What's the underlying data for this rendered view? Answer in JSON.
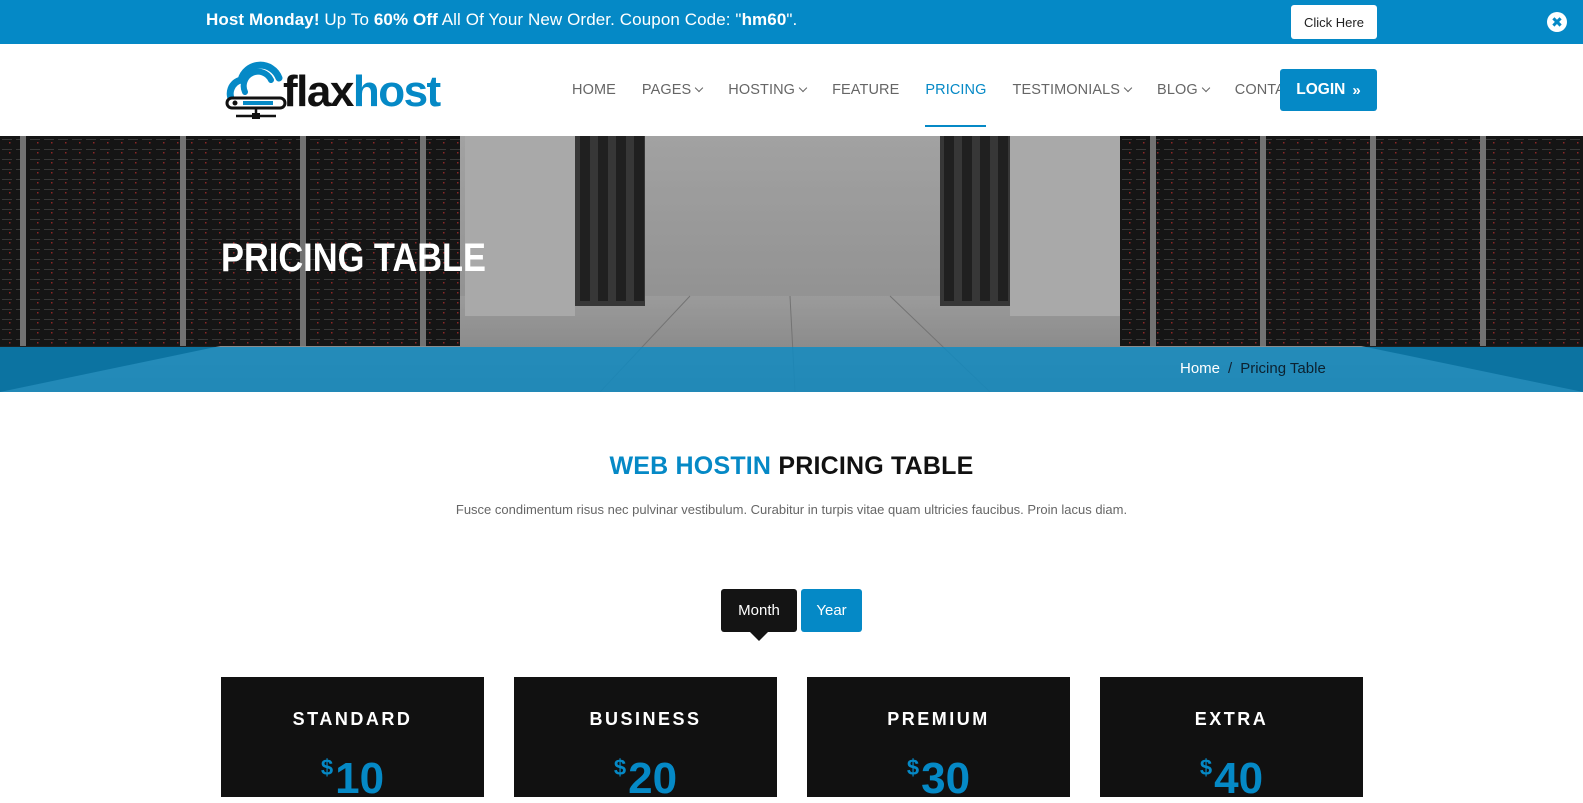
{
  "promo": {
    "strong_lead": "Host Monday!",
    "text_1": " Up To ",
    "strong_discount": "60% Off",
    "text_2": " All Of Your New Order. Coupon Code: \"",
    "strong_code": "hm60",
    "text_3": "\".",
    "button_label": "Click Here",
    "close_glyph": "✖"
  },
  "brand": {
    "part1": "flax",
    "part2": "host"
  },
  "nav": {
    "items": [
      {
        "label": "HOME",
        "dropdown": false
      },
      {
        "label": "PAGES",
        "dropdown": true
      },
      {
        "label": "HOSTING",
        "dropdown": true
      },
      {
        "label": "FEATURE",
        "dropdown": false
      },
      {
        "label": "PRICING",
        "dropdown": false,
        "active": true
      },
      {
        "label": "TESTIMONIALS",
        "dropdown": true
      },
      {
        "label": "BLOG",
        "dropdown": true
      },
      {
        "label": "CONTACT",
        "dropdown": false
      }
    ],
    "login_label": "LOGIN",
    "login_icon": "»"
  },
  "hero": {
    "title": "PRICING TABLE",
    "breadcrumb": {
      "home": "Home",
      "separator": "/",
      "current": "Pricing Table"
    }
  },
  "section": {
    "title_blue": "WEB HOSTIN",
    "title_dark": " PRICING TABLE",
    "description": "Fusce condimentum risus nec pulvinar vestibulum. Curabitur in turpis vitae quam ultricies faucibus. Proin lacus diam."
  },
  "billing_toggle": {
    "month_label": "Month",
    "year_label": "Year",
    "selected": "Month"
  },
  "plans": [
    {
      "name": "STANDARD",
      "currency": "$",
      "price": "10"
    },
    {
      "name": "BUSINESS",
      "currency": "$",
      "price": "20"
    },
    {
      "name": "PREMIUM",
      "currency": "$",
      "price": "30"
    },
    {
      "name": "EXTRA",
      "currency": "$",
      "price": "40"
    }
  ],
  "colors": {
    "accent": "#0589c6",
    "dark": "#111111",
    "text_muted": "#666666"
  }
}
